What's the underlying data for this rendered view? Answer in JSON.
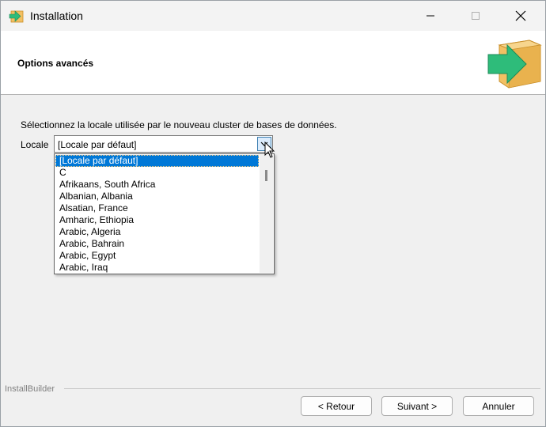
{
  "window": {
    "title": "Installation"
  },
  "titlebar": {
    "icons": [
      "app-icon",
      "minimize-icon",
      "maximize-icon",
      "close-icon"
    ]
  },
  "header": {
    "title": "Options avancés",
    "logo_icon": "installer-box-arrow-icon"
  },
  "content": {
    "description": "Sélectionnez la locale utilisée par le nouveau cluster de bases de données.",
    "locale_label": "Locale",
    "combo_value": "[Locale par défaut]",
    "dropdown_items": [
      "[Locale par défaut]",
      "C",
      "Afrikaans, South Africa",
      "Albanian, Albania",
      "Alsatian, France",
      "Amharic, Ethiopia",
      "Arabic, Algeria",
      "Arabic, Bahrain",
      "Arabic, Egypt",
      "Arabic, Iraq"
    ],
    "selected_index": 0
  },
  "footer": {
    "brand": "InstallBuilder",
    "back_label": "< Retour",
    "next_label": "Suivant >",
    "cancel_label": "Annuler"
  },
  "colors": {
    "selection": "#0078d7",
    "logo_green": "#2ebc7a",
    "logo_box": "#f2c063"
  }
}
